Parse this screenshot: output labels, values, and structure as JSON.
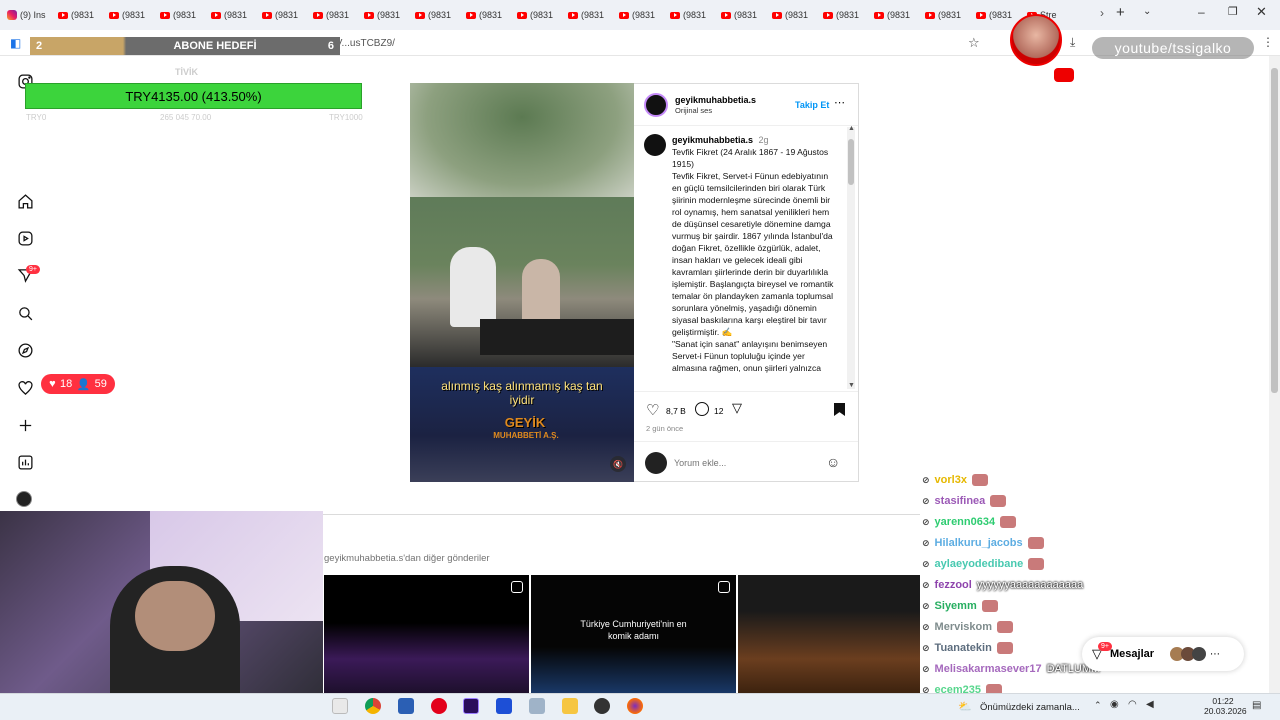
{
  "browser": {
    "tabs": [
      {
        "label": "(9) Ins",
        "icon": "instagram-icon"
      },
      {
        "label": "(9831",
        "icon": "youtube-icon"
      },
      {
        "label": "(9831",
        "icon": "youtube-icon"
      },
      {
        "label": "(9831",
        "icon": "youtube-icon"
      },
      {
        "label": "(9831",
        "icon": "youtube-icon"
      },
      {
        "label": "(9831",
        "icon": "youtube-icon"
      },
      {
        "label": "(9831",
        "icon": "youtube-icon"
      },
      {
        "label": "(9831",
        "icon": "youtube-icon"
      },
      {
        "label": "(9831",
        "icon": "youtube-icon"
      },
      {
        "label": "(9831",
        "icon": "youtube-icon"
      },
      {
        "label": "(9831",
        "icon": "youtube-icon"
      },
      {
        "label": "(9831",
        "icon": "youtube-icon"
      },
      {
        "label": "(9831",
        "icon": "youtube-icon"
      },
      {
        "label": "(9831",
        "icon": "youtube-icon"
      },
      {
        "label": "(9831",
        "icon": "youtube-icon"
      },
      {
        "label": "(9831",
        "icon": "youtube-icon"
      },
      {
        "label": "(9831",
        "icon": "youtube-icon"
      },
      {
        "label": "(9831",
        "icon": "youtube-icon"
      },
      {
        "label": "(9831",
        "icon": "youtube-icon"
      },
      {
        "label": "(9831",
        "icon": "youtube-icon"
      },
      {
        "label": "Stre",
        "icon": "stream-icon"
      }
    ],
    "url": "www.instagram.com/p/DV...usTCBZ9/"
  },
  "stream_overlay": {
    "abone_count": "2",
    "abone_label": "ABONE HEDEFİ",
    "abone_target": "6",
    "donation_label": "TİVİK",
    "donation_amount": "TRY4135.00 (413.50%)",
    "donation_min": "TRY0",
    "donation_mid": "265 045 70.00",
    "donation_max": "TRY1000",
    "channel": "youtube/tssigalko",
    "likes": "18",
    "viewers": "59"
  },
  "post": {
    "username": "geyikmuhabbetia.s",
    "audio": "Orijinal ses",
    "follow": "Takip Et",
    "caption_user": "geyikmuhabbetia.s",
    "caption_time": "2g",
    "caption": "Tevfik Fikret (24 Aralık 1867 - 19 Ağustos 1915)\nTevfik Fikret, Servet-i Fünun edebiyatının en güçlü temsilcilerinden biri olarak Türk şiirinin modernleşme sürecinde önemli bir rol oynamış, hem sanatsal yenilikleri hem de düşünsel cesaretiyle dönemine damga vurmuş bir şairdir. 1867 yılında İstanbul'da doğan Fikret, özellikle özgürlük, adalet, insan hakları ve gelecek ideali gibi kavramları şiirlerinde derin bir duyarlılıkla işlemiştir. Başlangıçta bireysel ve romantik temalar ön plandayken zamanla toplumsal sorunlara yönelmiş, yaşadığı dönemin siyasal baskılarına karşı eleştirel bir tavır geliştirmiştir. ✍️\n\"Sanat için sanat\" anlayışını benimseyen Servet-i Fünun topluluğu içinde yer almasına rağmen, onun şiirleri yalnızca",
    "likes": "8,7 B",
    "comments": "12",
    "date": "2 gün önce",
    "comment_placeholder": "Yorum ekle...",
    "subtitle": "alınmış kaş alınmamış kaş tan iyidir",
    "watermark_top": "GEYİK",
    "watermark_bottom": "MUHABBETİ A.Ş.",
    "more_from": "geyikmuhabbetia.s'dan diğer gönderiler",
    "thumb2_text": "Türkiye Cumhuriyeti'nin en komik adamı"
  },
  "nav": {
    "notification_badge": "9+"
  },
  "chat": [
    {
      "user": "vorl3x",
      "msg": "",
      "color": "#e6b800"
    },
    {
      "user": "stasifinea",
      "msg": "",
      "color": "#9b59b6"
    },
    {
      "user": "yarenn0634",
      "msg": "",
      "color": "#2ecc71"
    },
    {
      "user": "Hilalkuru_jacobs",
      "msg": "",
      "color": "#5dade2"
    },
    {
      "user": "aylaeyodedibane",
      "msg": "",
      "color": "#48c9b0"
    },
    {
      "user": "fezzool",
      "msg": "yyyyyyaaaaaaaaaaaa",
      "color": "#8e44ad"
    },
    {
      "user": "Siyemm",
      "msg": "",
      "color": "#27ae60"
    },
    {
      "user": "Merviskom",
      "msg": "",
      "color": "#7f8c8d"
    },
    {
      "user": "Tuanatekin",
      "msg": "",
      "color": "#5d6d7e"
    },
    {
      "user": "Melisakarmasever17",
      "msg": "DATLUMM",
      "color": "#a569bd"
    },
    {
      "user": "ecem235",
      "msg": "",
      "color": "#58d68d"
    }
  ],
  "messages": {
    "label": "Mesajlar",
    "badge": "9+"
  },
  "taskbar": {
    "weather": "Önümüzdeki zamanla...",
    "time": "01:22",
    "date": "20.03.2026"
  },
  "colors": {
    "progress_green": "#3cd43c",
    "badge_red": "#ff3040",
    "instagram_blue": "#0095f6"
  }
}
